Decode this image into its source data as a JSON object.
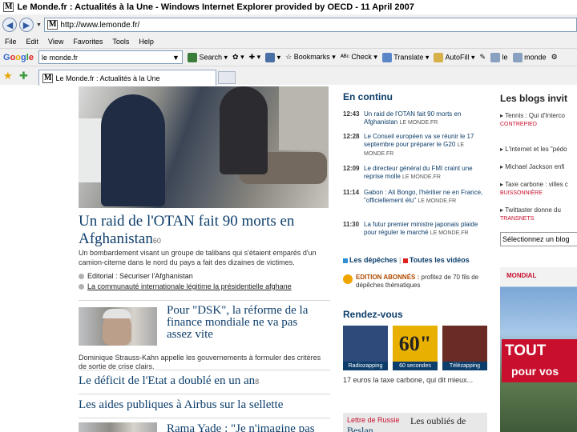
{
  "browser": {
    "title": "Le Monde.fr : Actualités à la Une - Windows Internet Explorer provided by OECD - 11 April 2007",
    "url": "http://www.lemonde.fr/",
    "menu": [
      "File",
      "Edit",
      "View",
      "Favorites",
      "Tools",
      "Help"
    ],
    "google": {
      "logo": [
        "G",
        "o",
        "o",
        "g",
        "l",
        "e"
      ],
      "query": "le monde.fr",
      "buttons": [
        "Search",
        "Bookmarks",
        "Check",
        "Translate",
        "AutoFill",
        "le",
        "monde"
      ]
    },
    "tab_label": "Le Monde.fr : Actualités à la Une"
  },
  "main": {
    "headline": "Un raid de l'OTAN fait 90 morts en Afghanistan",
    "headline_comments": "60",
    "lead": "Un bombardement visant un groupe de talibans qui s'étaient emparés d'un camion-citerne dans le nord du pays a fait des dizaines de victimes.",
    "bullets": [
      "Editorial : Sécuriser l'Afghanistan",
      "La communauté internationale légitime la présidentielle afghane"
    ],
    "story2": {
      "title": "Pour \"DSK\", la réforme de la finance mondiale ne va pas assez vite",
      "text": "Dominique Strauss-Kahn appelle les gouvernements à formuler des critères de sortie de crise clairs."
    },
    "story3": "Le déficit de l'Etat a doublé en un an",
    "story3_comments": "8",
    "story4": "Les aides publiques à Airbus sur la sellette",
    "story5": "Rama Yade : \"Je n'imagine pas"
  },
  "en_continu": {
    "title": "En continu",
    "items": [
      {
        "time": "12:43",
        "text": "Un raid de l'OTAN fait 90 morts en Afghanistan",
        "src": "LE MONDE.FR"
      },
      {
        "time": "12:28",
        "text": "Le Conseil européen va se réunir le 17 septembre pour préparer le G20",
        "src": "LE MONDE.FR"
      },
      {
        "time": "12:09",
        "text": "Le directeur général du FMI craint une reprise molle",
        "src": "LE MONDE.FR"
      },
      {
        "time": "11:14",
        "text": "Gabon : Ali Bongo, l'héritier ne en France, \"officiellement élu\"",
        "src": "LE MONDE.FR"
      },
      {
        "time": "11:30",
        "text": "La futur premier ministre japonais plaide pour réguler le marché",
        "src": "LE MONDE.FR"
      }
    ],
    "depeches": "Les dépêches",
    "videos": "Toutes les vidéos",
    "edition_label": "EDITION ABONNÉS :",
    "edition_text": "profitez de 70 fils de dépêches thématiques"
  },
  "rendez_vous": {
    "title": "Rendez-vous",
    "tiles": [
      {
        "caption": "Radiozapping",
        "big": "",
        "color": "#2d4a7a"
      },
      {
        "caption": "60 secondes",
        "big": "60\"",
        "color": "#e8b000"
      },
      {
        "caption": "Télézapping",
        "big": "",
        "color": "#6a2b24"
      }
    ],
    "note": "17 euros la taxe carbone, qui dit mieux...",
    "lettre_label": "Lettre de Russie",
    "lettre_title": "Les oubliés de",
    "lettre_subtitle": "Beslan"
  },
  "blogs": {
    "title": "Les blogs invit",
    "items": [
      {
        "text": "Tennis : Qui d'Interco",
        "author": "CONTREPIED"
      },
      {
        "text": "L'Internet et les \"pédo",
        "author": ""
      },
      {
        "text": "Michael Jackson enfi",
        "author": ""
      },
      {
        "text": "Taxe carbone : villes c",
        "author": "BUISSONNIÈRE"
      },
      {
        "text": "Twittaster donne du",
        "author": "TRANSNETS"
      }
    ],
    "select": "Sélectionnez un blog",
    "ad_brand": "MONDIAL",
    "ad_line1": "TOUT",
    "ad_line2": "pour vos"
  },
  "colors": {
    "link": "#0d3e6b",
    "accent_red": "#c8102e",
    "chrome": "#f0f0f0"
  }
}
